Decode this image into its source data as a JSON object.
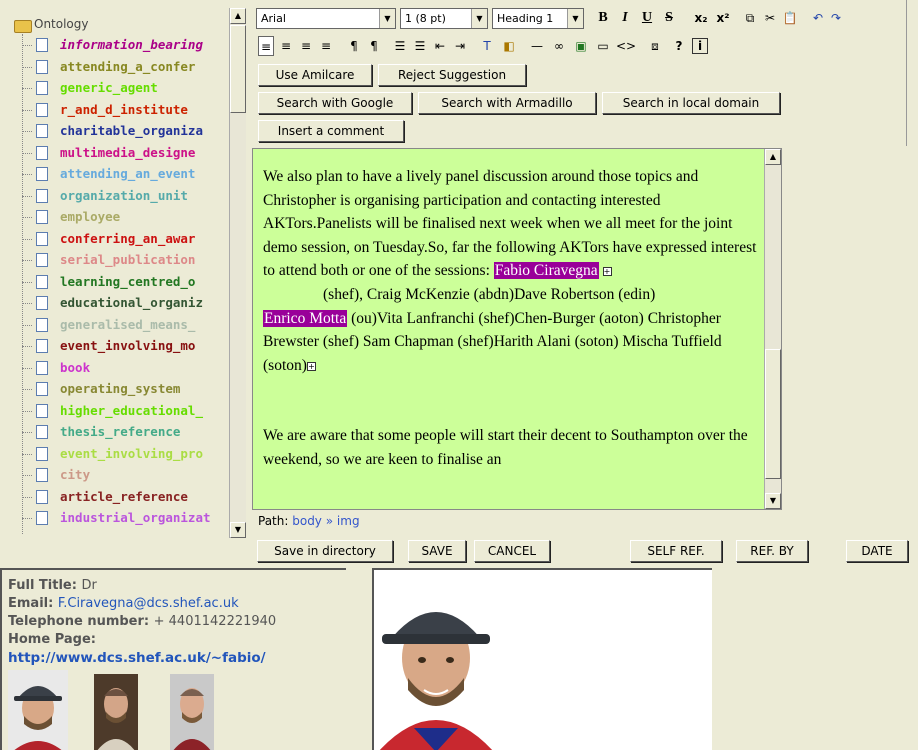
{
  "tree": {
    "root_label": "Ontology",
    "items": [
      {
        "label": "information_bearing",
        "color": "#aa0088",
        "italic": true
      },
      {
        "label": "attending_a_confer",
        "color": "#888822"
      },
      {
        "label": "generic_agent",
        "color": "#66dd00"
      },
      {
        "label": "r_and_d_institute",
        "color": "#cc2200"
      },
      {
        "label": "charitable_organiza",
        "color": "#223399"
      },
      {
        "label": "multimedia_designe",
        "color": "#cc1188"
      },
      {
        "label": "attending_an_event",
        "color": "#66aadd"
      },
      {
        "label": "organization_unit",
        "color": "#55aaaa"
      },
      {
        "label": "employee",
        "color": "#aaaa66"
      },
      {
        "label": "conferring_an_awar",
        "color": "#cc1111"
      },
      {
        "label": "serial_publication",
        "color": "#dd8888"
      },
      {
        "label": "learning_centred_o",
        "color": "#227722"
      },
      {
        "label": "educational_organiz",
        "color": "#335533"
      },
      {
        "label": "generalised_means_",
        "color": "#aabbaa"
      },
      {
        "label": "event_involving_mo",
        "color": "#881111"
      },
      {
        "label": "book",
        "color": "#cc33cc"
      },
      {
        "label": "operating_system",
        "color": "#888833"
      },
      {
        "label": "higher_educational_",
        "color": "#66dd00"
      },
      {
        "label": "thesis_reference",
        "color": "#44aa88"
      },
      {
        "label": "event_involving_pro",
        "color": "#aadd44"
      },
      {
        "label": "city",
        "color": "#cc9988"
      },
      {
        "label": "article_reference",
        "color": "#882222"
      },
      {
        "label": "industrial_organizat",
        "color": "#bb55dd"
      }
    ]
  },
  "toolbar": {
    "font": "Arial",
    "size": "1 (8 pt)",
    "style": "Heading 1",
    "bold": "B",
    "italic": "I",
    "underline": "U",
    "strike": "S",
    "sub": "x₂",
    "sup": "x²",
    "help": "?",
    "info": "i",
    "use_amilcare": "Use Amilcare",
    "reject_suggestion": "Reject Suggestion",
    "search_google": "Search with Google",
    "search_armadillo": "Search with Armadillo",
    "search_local": "Search in local domain",
    "insert_comment": "Insert a comment"
  },
  "editor": {
    "p1_a": "We also plan to have a lively panel discussion around those topics and Christopher is organising participation and contacting interested AKTors.Panelists will be finalised next week when we all meet for the joint demo session, on Tuesday.So, far the following AKTors have expressed interest to attend both or one of the sessions: ",
    "hl1": "Fabio Ciravegna",
    "p1_b": "(shef), Craig McKenzie (abdn)Dave Robertson (edin)",
    "hl2": "Enrico Motta",
    "p1_c": " (ou)Vita Lanfranchi (shef)Chen-Burger (aoton) Christopher Brewster (shef) Sam Chapman (shef)Harith Alani (soton) Mischa Tuffield (soton)",
    "p2": "We are aware that some people will start their decent to Southampton over the weekend, so we are keen to finalise an",
    "plus": "+"
  },
  "path": {
    "label": "Path:",
    "body": "body",
    "sep": "»",
    "img": "img"
  },
  "actions": {
    "save_dir": "Save in directory",
    "save": "SAVE",
    "cancel": "CANCEL",
    "self_ref": "SELF REF.",
    "ref_by": "REF. BY",
    "date": "DATE"
  },
  "info": {
    "title_label": "Full Title:",
    "title_value": "Dr",
    "email_label": "Email:",
    "email_value": "F.Ciravegna@dcs.shef.ac.uk",
    "phone_label": "Telephone number:",
    "phone_value": "+ 4401142221940",
    "home_label": "Home Page:",
    "home_value": "http://www.dcs.shef.ac.uk/~fabio/"
  }
}
